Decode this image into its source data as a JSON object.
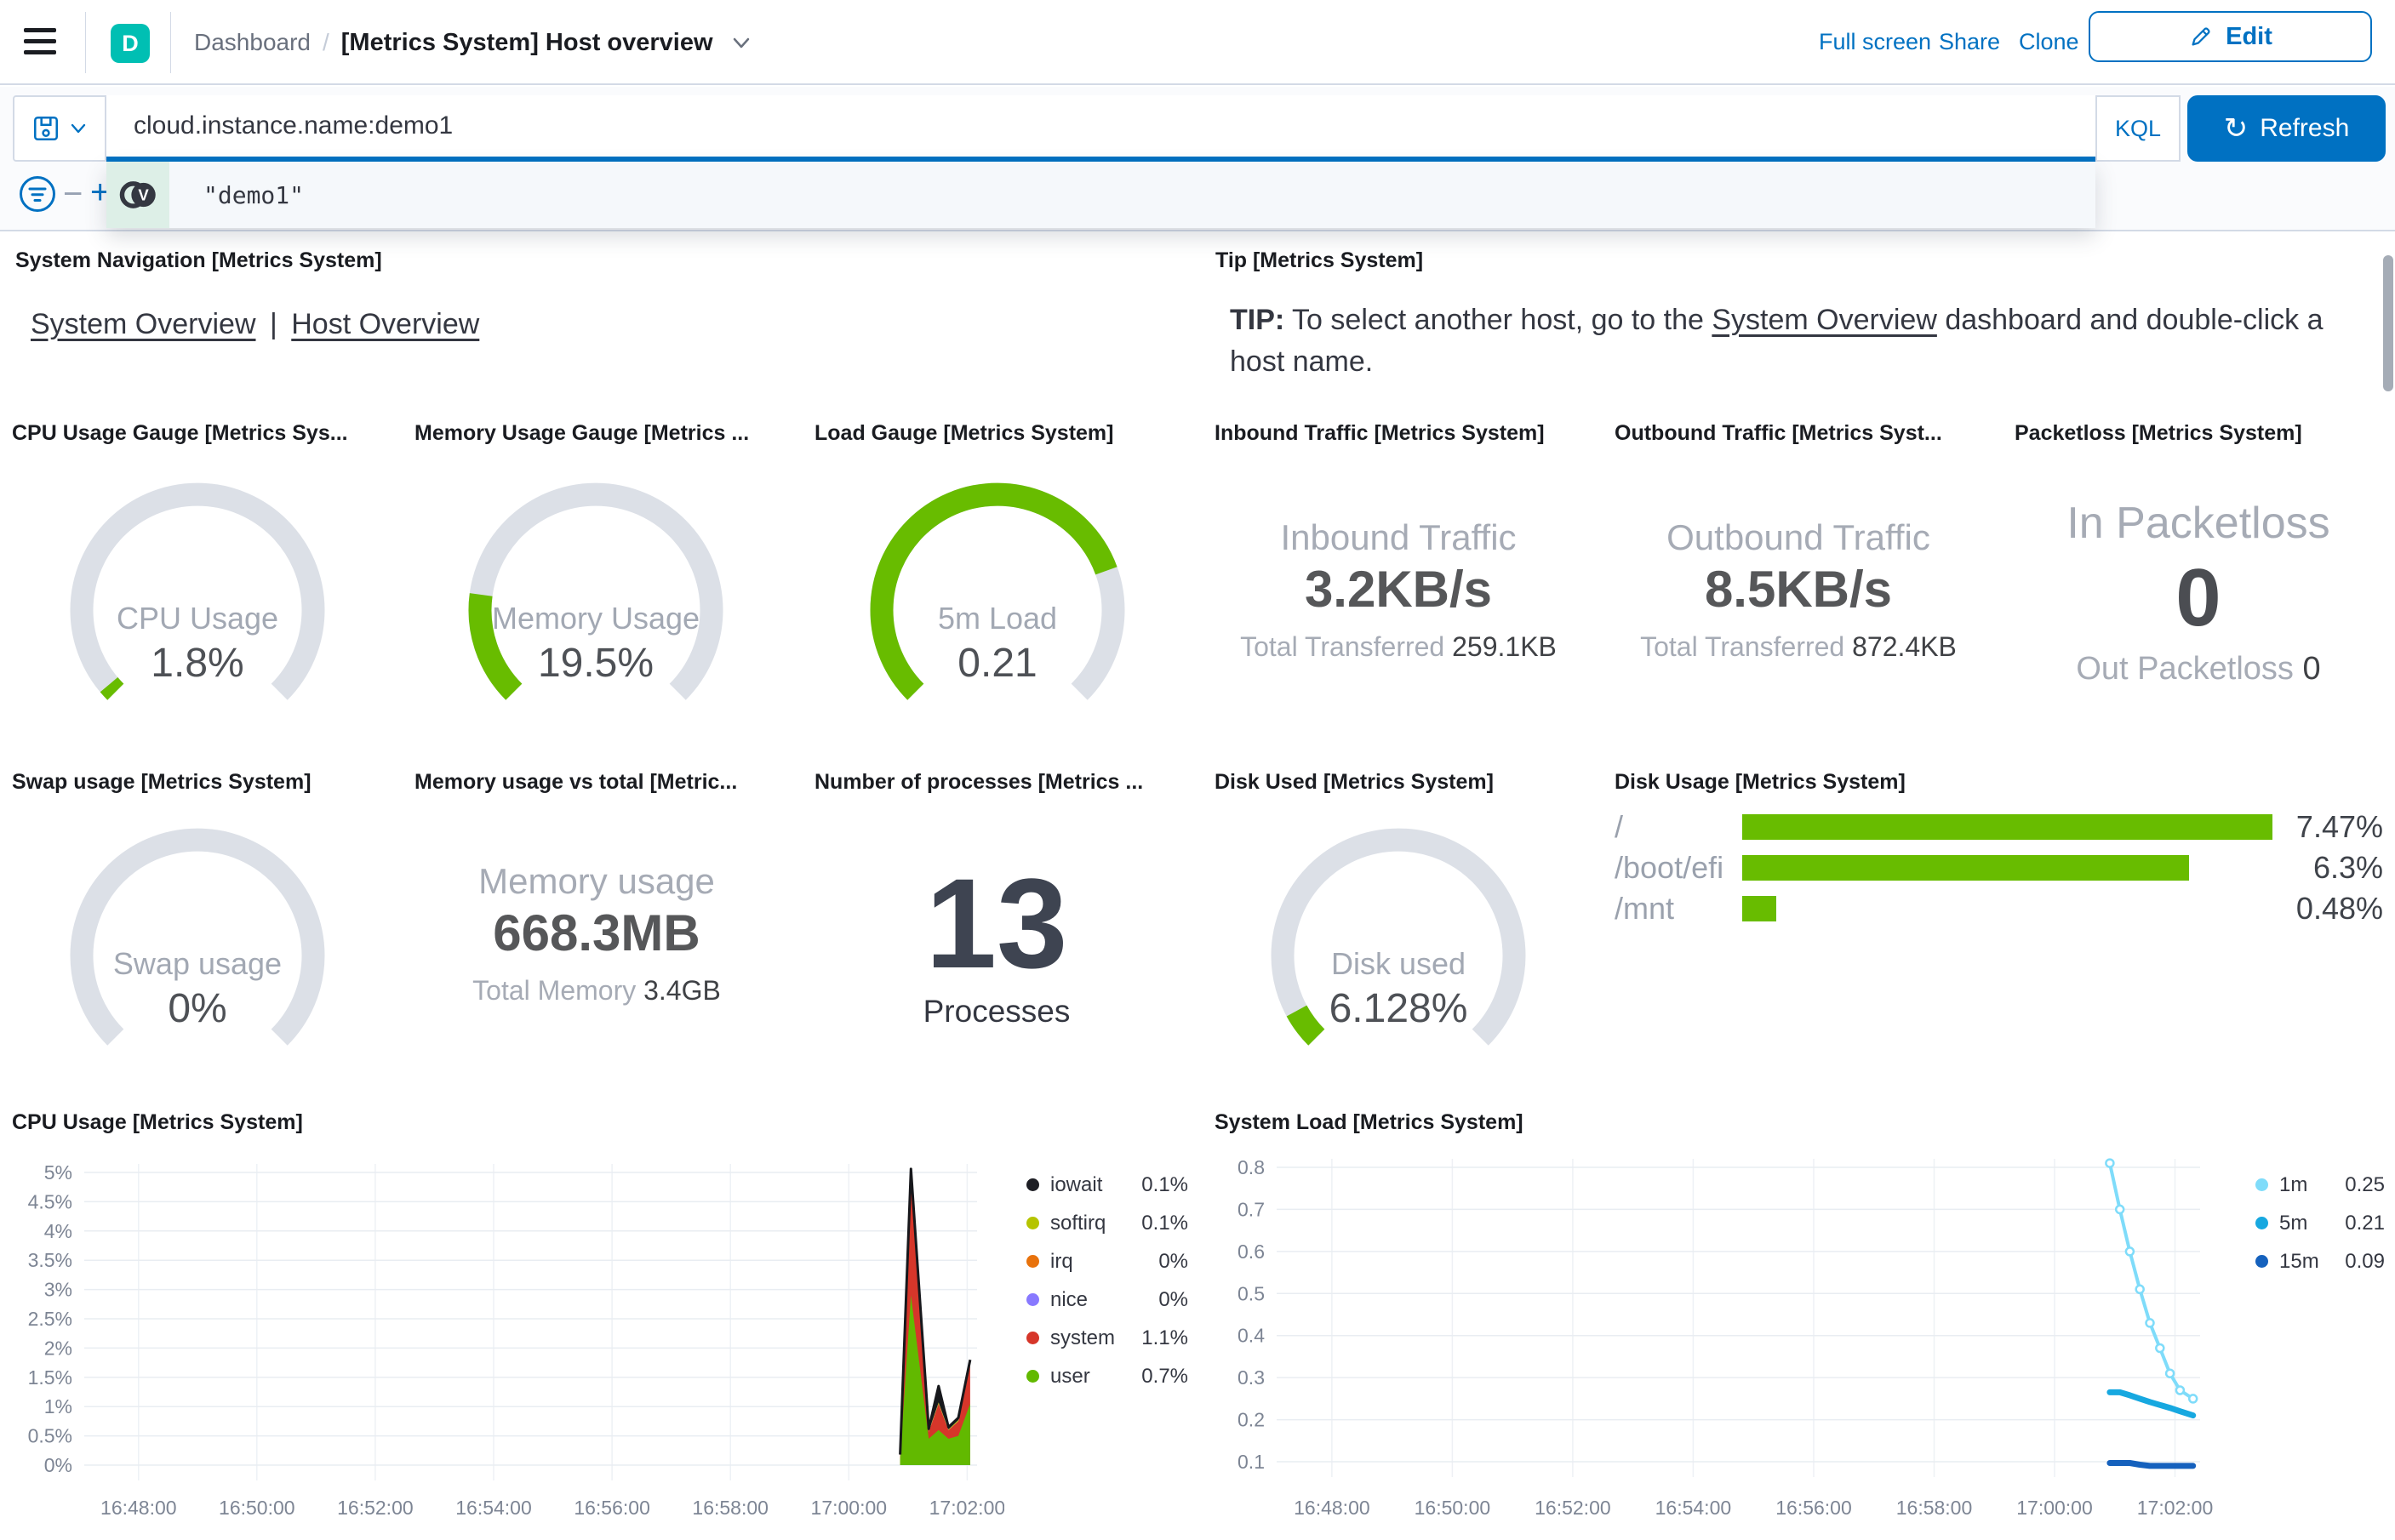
{
  "colors": {
    "accent_blue": "#0071C2",
    "brand_teal": "#00BFB3",
    "gauge_green": "#68BC00",
    "gauge_track": "#DCE0E7",
    "area_red": "#D6362A",
    "area_green": "#62B900"
  },
  "header": {
    "avatar_letter": "D",
    "breadcrumb": {
      "app": "Dashboard",
      "separator": "/",
      "title": "[Metrics System] Host overview"
    },
    "actions": {
      "full_screen": "Full screen",
      "share": "Share",
      "clone": "Clone",
      "edit": "Edit"
    }
  },
  "query_bar": {
    "query": "cloud.instance.name:demo1",
    "language": "KQL",
    "refresh_label": "Refresh",
    "suggestion": {
      "value": "\"demo1\""
    }
  },
  "panels": {
    "system_navigation": {
      "title": "System Navigation [Metrics System]",
      "links": {
        "first": "System Overview",
        "second": "Host Overview"
      },
      "separator": "|"
    },
    "tip": {
      "title": "Tip [Metrics System]",
      "bold_prefix": "TIP:",
      "text_before_link": " To select another host, go to the ",
      "link_text": "System Overview",
      "text_after_link": " dashboard and double-click a host name."
    },
    "cpu_gauge": {
      "title": "CPU Usage Gauge [Metrics Sys...",
      "label": "CPU Usage",
      "value": "1.8%",
      "fraction": 0.018
    },
    "memory_gauge": {
      "title": "Memory Usage Gauge [Metrics ...",
      "label": "Memory Usage",
      "value": "19.5%",
      "fraction": 0.195
    },
    "load_gauge": {
      "title": "Load Gauge [Metrics System]",
      "label": "5m Load",
      "value": "0.21",
      "fraction": 0.76
    },
    "inbound_traffic": {
      "title": "Inbound Traffic [Metrics System]",
      "label": "Inbound Traffic",
      "value": "3.2KB/s",
      "total_label": "Total Transferred",
      "total_value": "259.1KB"
    },
    "outbound_traffic": {
      "title": "Outbound Traffic [Metrics Syst...",
      "label": "Outbound Traffic",
      "value": "8.5KB/s",
      "total_label": "Total Transferred",
      "total_value": "872.4KB"
    },
    "packetloss": {
      "title": "Packetloss [Metrics System]",
      "label": "In Packetloss",
      "value": "0",
      "secondary_label": "Out Packetloss",
      "secondary_value": "0"
    },
    "swap_gauge": {
      "title": "Swap usage [Metrics System]",
      "label": "Swap usage",
      "value": "0%",
      "fraction": 0
    },
    "memory_vs_total": {
      "title": "Memory usage vs total [Metric...",
      "label": "Memory usage",
      "value": "668.3MB",
      "total_label": "Total Memory",
      "total_value": "3.4GB"
    },
    "processes": {
      "title": "Number of processes [Metrics ...",
      "value": "13",
      "label": "Processes"
    },
    "disk_used_gauge": {
      "title": "Disk Used [Metrics System]",
      "label": "Disk used",
      "value": "6.128%",
      "fraction": 0.061
    },
    "disk_usage": {
      "title": "Disk Usage [Metrics System]",
      "max_value": 7.47,
      "bar_color": "#68BC00",
      "rows": [
        {
          "label": "/",
          "value": "7.47%",
          "pct": 7.47
        },
        {
          "label": "/boot/efi",
          "value": "6.3%",
          "pct": 6.3
        },
        {
          "label": "/mnt",
          "value": "0.48%",
          "pct": 0.48
        }
      ]
    }
  },
  "chart_data": [
    {
      "id": "cpu_usage",
      "type": "area",
      "title": "CPU Usage [Metrics System]",
      "stacked": true,
      "grid": true,
      "legend_position": "right",
      "x_domain": [
        "16:47:05",
        "17:02:10"
      ],
      "x_ticks": [
        "16:48:00",
        "16:50:00",
        "16:52:00",
        "16:54:00",
        "16:56:00",
        "16:58:00",
        "17:00:00",
        "17:02:00"
      ],
      "y_tick_vals": [
        0,
        0.5,
        1,
        1.5,
        2,
        2.5,
        3,
        3.5,
        4,
        4.5,
        5
      ],
      "y_tick_labels": [
        "0%",
        "0.5%",
        "1%",
        "1.5%",
        "2%",
        "2.5%",
        "3%",
        "3.5%",
        "4%",
        "4.5%",
        "5%"
      ],
      "ylim": [
        0,
        5.25
      ],
      "x": [
        "17:00:52",
        "17:01:03",
        "17:01:21",
        "17:01:31",
        "17:01:41",
        "17:01:51",
        "17:02:03"
      ],
      "series": [
        {
          "name": "user",
          "color": "#62B900",
          "values": [
            0.1,
            2.9,
            0.45,
            0.6,
            0.45,
            0.5,
            1.05
          ]
        },
        {
          "name": "system",
          "color": "#D6362A",
          "values": [
            0.05,
            2.05,
            0.12,
            0.45,
            0.15,
            0.25,
            0.65
          ]
        },
        {
          "name": "softirq",
          "color": "#B5C400",
          "values": [
            0.01,
            0.03,
            0.01,
            0.02,
            0.01,
            0.02,
            0.04
          ]
        },
        {
          "name": "iowait",
          "color": "#17181C",
          "values": [
            0.02,
            0.08,
            0.04,
            0.28,
            0.04,
            0.04,
            0.06
          ]
        }
      ],
      "legend": [
        {
          "label": "iowait",
          "value": "0.1%",
          "color": "#1D1E24"
        },
        {
          "label": "softirq",
          "value": "0.1%",
          "color": "#B5C400"
        },
        {
          "label": "irq",
          "value": "0%",
          "color": "#E8720C"
        },
        {
          "label": "nice",
          "value": "0%",
          "color": "#8879FF"
        },
        {
          "label": "system",
          "value": "1.1%",
          "color": "#D6362A"
        },
        {
          "label": "user",
          "value": "0.7%",
          "color": "#62B900"
        }
      ]
    },
    {
      "id": "system_load",
      "type": "line",
      "title": "System Load [Metrics System]",
      "grid": true,
      "legend_position": "right",
      "x_domain": [
        "16:47:05",
        "17:02:25"
      ],
      "x_ticks": [
        "16:48:00",
        "16:50:00",
        "16:52:00",
        "16:54:00",
        "16:56:00",
        "16:58:00",
        "17:00:00",
        "17:02:00"
      ],
      "y_tick_vals": [
        0.1,
        0.2,
        0.3,
        0.4,
        0.5,
        0.6,
        0.7,
        0.8
      ],
      "y_tick_labels": [
        "0.1",
        "0.2",
        "0.3",
        "0.4",
        "0.5",
        "0.6",
        "0.7",
        "0.8"
      ],
      "ylim": [
        0.05,
        0.84
      ],
      "x": [
        "17:00:55",
        "17:01:05",
        "17:01:15",
        "17:01:25",
        "17:01:35",
        "17:01:45",
        "17:01:55",
        "17:02:05",
        "17:02:18"
      ],
      "series": [
        {
          "name": "1m",
          "color": "#7FDCFA",
          "width": 4,
          "markers": true,
          "values": [
            0.81,
            0.7,
            0.6,
            0.51,
            0.43,
            0.37,
            0.31,
            0.27,
            0.25
          ]
        },
        {
          "name": "5m",
          "color": "#17A8E0",
          "width": 7,
          "markers": false,
          "values": [
            0.265,
            0.265,
            0.258,
            0.25,
            0.242,
            0.235,
            0.228,
            0.22,
            0.21
          ]
        },
        {
          "name": "15m",
          "color": "#1561BD",
          "width": 7,
          "markers": false,
          "values": [
            0.097,
            0.097,
            0.097,
            0.093,
            0.09,
            0.09,
            0.09,
            0.09,
            0.09
          ]
        }
      ],
      "legend": [
        {
          "label": "1m",
          "value": "0.25",
          "color": "#7FDCFA"
        },
        {
          "label": "5m",
          "value": "0.21",
          "color": "#17A8E0"
        },
        {
          "label": "15m",
          "value": "0.09",
          "color": "#1561BD"
        }
      ]
    }
  ]
}
